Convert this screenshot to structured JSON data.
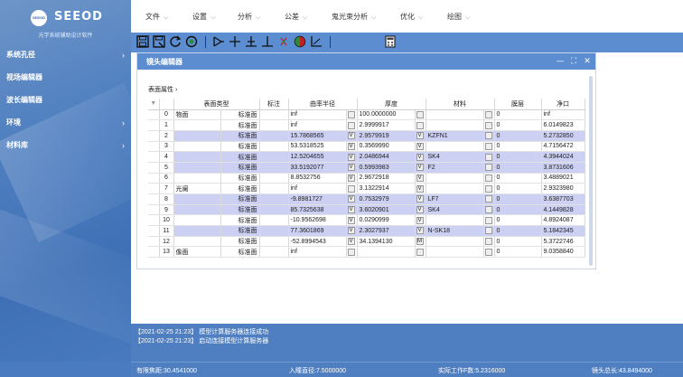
{
  "app": {
    "logo_mark": "SEEOD",
    "name": "SEEOD",
    "subtitle": "光学系统辅助设计软件"
  },
  "sidebar": {
    "items": [
      {
        "label": "系统孔径",
        "chevron": "›"
      },
      {
        "label": "视场编辑器",
        "chevron": ""
      },
      {
        "label": "波长编辑器",
        "chevron": ""
      },
      {
        "label": "环境",
        "chevron": "›"
      },
      {
        "label": "材料库",
        "chevron": "›"
      }
    ]
  },
  "menu": {
    "items": [
      {
        "label": "文件",
        "chevron": "⌵"
      },
      {
        "label": "设置",
        "chevron": "⌵"
      },
      {
        "label": "分析",
        "chevron": "⌵"
      },
      {
        "label": "公差",
        "chevron": "⌵"
      },
      {
        "label": "鬼光束分析",
        "chevron": "⌵"
      },
      {
        "label": "优化",
        "chevron": "⌵"
      },
      {
        "label": "绘图",
        "chevron": "⌵"
      }
    ]
  },
  "toolbar": {
    "icons": [
      "save-icon",
      "save-as-icon",
      "refresh-icon",
      "target-icon",
      "lens-add-icon",
      "crosshair-icon",
      "surface-add-icon",
      "surface-insert-icon",
      "ray-trace-icon",
      "aperture-icon",
      "layout-icon",
      "calculator-icon"
    ]
  },
  "editor": {
    "title": "镜头编辑器",
    "controls": {
      "minimize": "—",
      "restore": "⛶",
      "close": "✕"
    },
    "surface_props_label": "表面属性 ›",
    "columns": {
      "surface_type": "表面类型",
      "comment": "标注",
      "radius": "曲率半径",
      "thickness": "厚度",
      "material": "材料",
      "coating": "膜层",
      "clear_semi": "净口"
    },
    "rows": [
      {
        "idx": "0",
        "name": "物面",
        "type": "标准面",
        "comment": "",
        "radius": "inf",
        "rflag": "",
        "thick": "100.0000000",
        "tflag": "",
        "mat": "",
        "coat": "0",
        "semi": "inf",
        "hl": false
      },
      {
        "idx": "1",
        "name": "",
        "type": "标准面",
        "comment": "",
        "radius": "inf",
        "rflag": "",
        "thick": "2.9999917",
        "tflag": "",
        "mat": "",
        "coat": "0",
        "semi": "6.0149823",
        "hl": false
      },
      {
        "idx": "2",
        "name": "",
        "type": "标准面",
        "comment": "",
        "radius": "15.7868565",
        "rflag": "V",
        "thick": "2.9579919",
        "tflag": "V",
        "mat": "KZFN1",
        "coat": "0",
        "semi": "5.2732850",
        "hl": true
      },
      {
        "idx": "3",
        "name": "",
        "type": "标准面",
        "comment": "",
        "radius": "53.5318525",
        "rflag": "V",
        "thick": "0.3569990",
        "tflag": "V",
        "mat": "",
        "coat": "0",
        "semi": "4.7156472",
        "hl": false
      },
      {
        "idx": "4",
        "name": "",
        "type": "标准面",
        "comment": "",
        "radius": "12.5204655",
        "rflag": "V",
        "thick": "2.0486944",
        "tflag": "V",
        "mat": "SK4",
        "coat": "0",
        "semi": "4.3944024",
        "hl": true
      },
      {
        "idx": "5",
        "name": "",
        "type": "标准面",
        "comment": "",
        "radius": "33.5192077",
        "rflag": "V",
        "thick": "0.5993983",
        "tflag": "V",
        "mat": "F2",
        "coat": "0",
        "semi": "3.8731606",
        "hl": true
      },
      {
        "idx": "6",
        "name": "",
        "type": "标准面",
        "comment": "",
        "radius": "8.8532756",
        "rflag": "V",
        "thick": "2.9672918",
        "tflag": "V",
        "mat": "",
        "coat": "0",
        "semi": "3.4889021",
        "hl": false
      },
      {
        "idx": "7",
        "name": "光阑",
        "type": "标准面",
        "comment": "",
        "radius": "inf",
        "rflag": "",
        "thick": "3.1322914",
        "tflag": "V",
        "mat": "",
        "coat": "0",
        "semi": "2.9323980",
        "hl": false
      },
      {
        "idx": "8",
        "name": "",
        "type": "标准面",
        "comment": "",
        "radius": "-9.8981727",
        "rflag": "V",
        "thick": "0.7532979",
        "tflag": "V",
        "mat": "LF7",
        "coat": "0",
        "semi": "3.6387703",
        "hl": true
      },
      {
        "idx": "9",
        "name": "",
        "type": "标准面",
        "comment": "",
        "radius": "85.7325638",
        "rflag": "V",
        "thick": "3.6020901",
        "tflag": "V",
        "mat": "SK4",
        "coat": "0",
        "semi": "4.1449828",
        "hl": true
      },
      {
        "idx": "10",
        "name": "",
        "type": "标准面",
        "comment": "",
        "radius": "-10.9562698",
        "rflag": "V",
        "thick": "0.0290999",
        "tflag": "V",
        "mat": "",
        "coat": "0",
        "semi": "4.8924087",
        "hl": false
      },
      {
        "idx": "11",
        "name": "",
        "type": "标准面",
        "comment": "",
        "radius": "77.3601869",
        "rflag": "V",
        "thick": "2.3027937",
        "tflag": "V",
        "mat": "N-SK18",
        "coat": "0",
        "semi": "5.1842345",
        "hl": true
      },
      {
        "idx": "12",
        "name": "",
        "type": "标准面",
        "comment": "",
        "radius": "-52.8994543",
        "rflag": "V",
        "thick": "34.1394130",
        "tflag": "M",
        "mat": "",
        "coat": "0",
        "semi": "5.3722746",
        "hl": false
      },
      {
        "idx": "13",
        "name": "像面",
        "type": "标准面",
        "comment": "",
        "radius": "inf",
        "rflag": "",
        "thick": "",
        "tflag": "",
        "mat": "",
        "coat": "0",
        "semi": "9.0358840",
        "hl": false
      }
    ]
  },
  "log": {
    "lines": [
      "【2021-02-25 21:23】 模型计算服务器连接成功",
      "【2021-02-25 21:23】 启动连接模型计算服务器"
    ]
  },
  "status": {
    "effective_focal": "有限焦距:30.4541000",
    "entrance_pupil": "入瞳直径:7.5000000",
    "working_fnum": "实际工作F数:5.2316000",
    "total_length": "镜头总长:43.8494000"
  }
}
